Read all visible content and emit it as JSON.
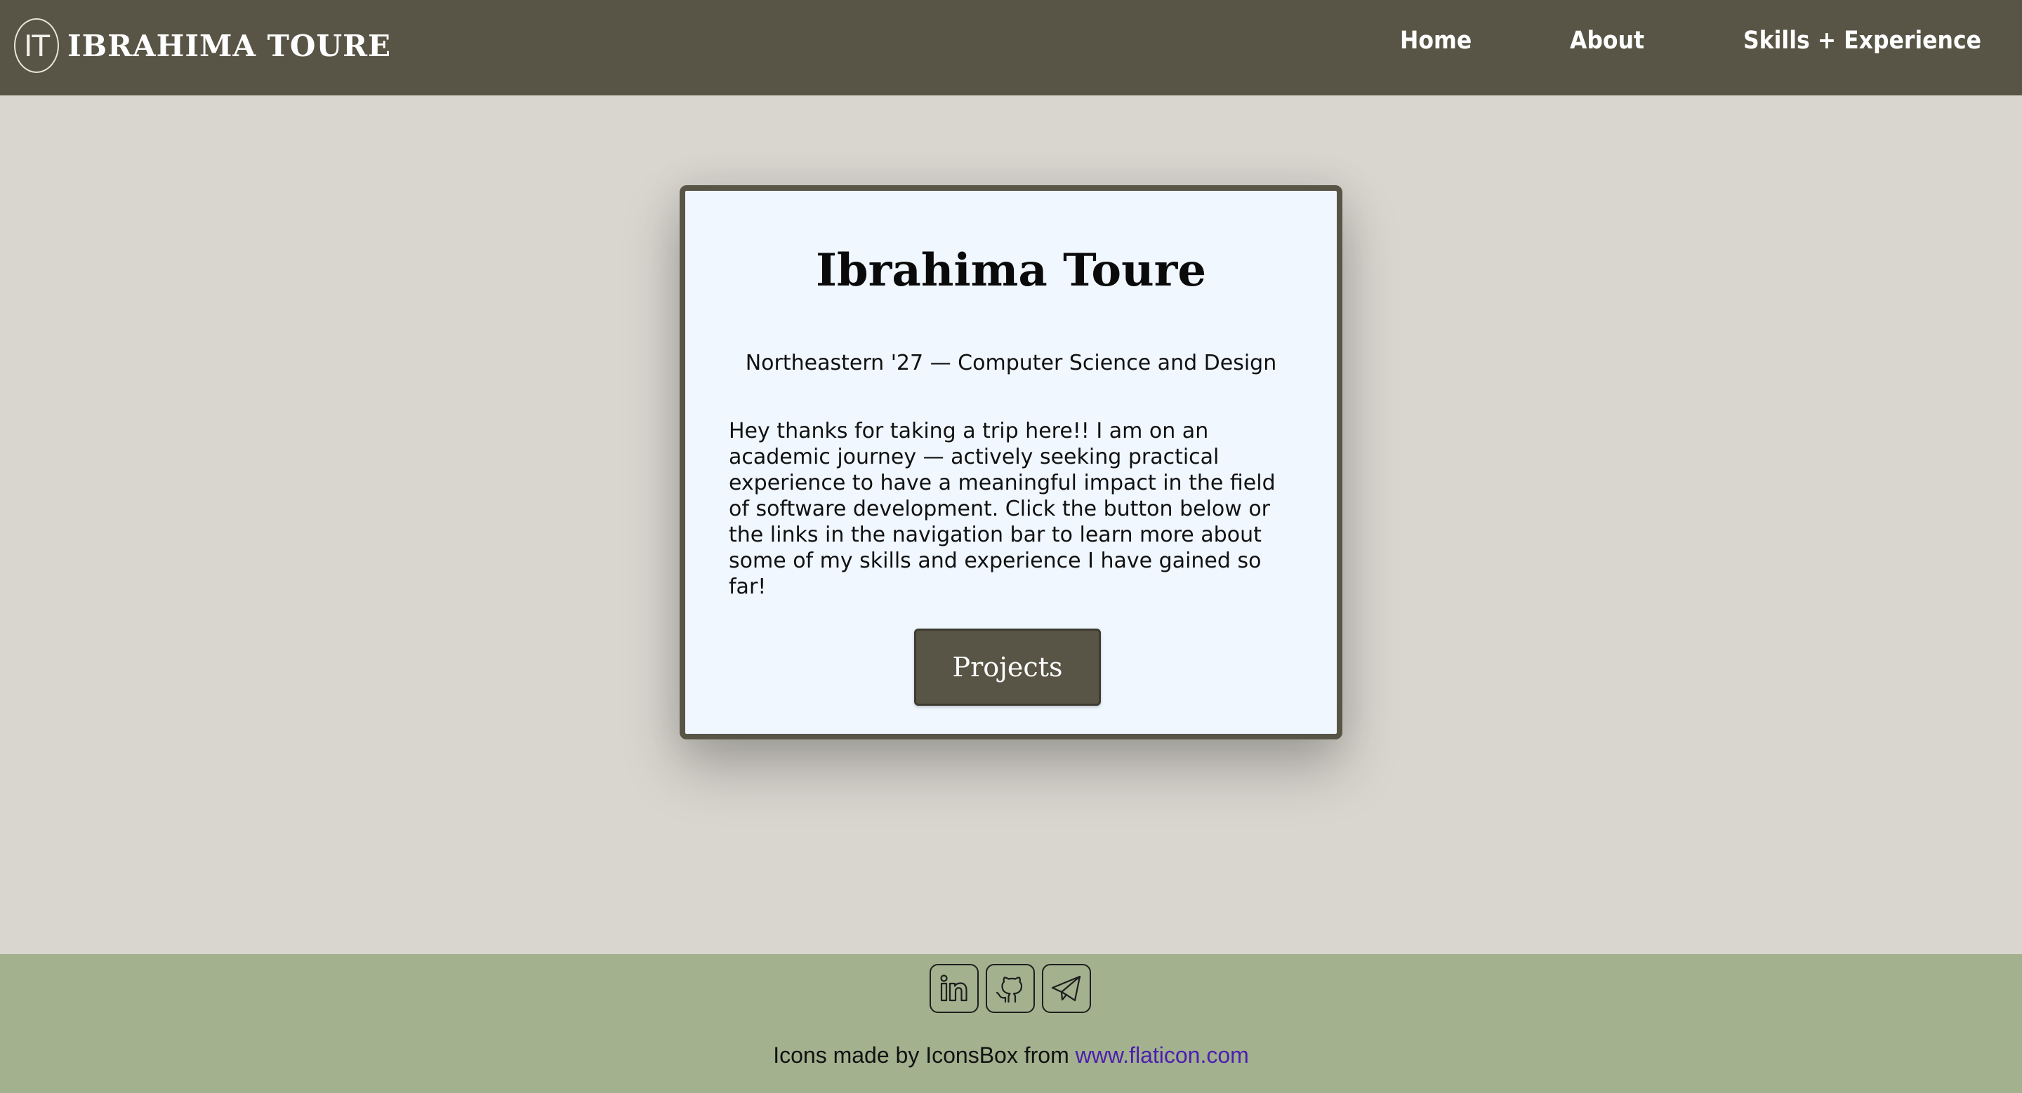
{
  "header": {
    "logo_text": "IT",
    "brand_name": "IBRAHIMA TOURE",
    "nav": {
      "home": "Home",
      "about": "About",
      "skills": "Skills + Experience"
    }
  },
  "card": {
    "title": "Ibrahima Toure",
    "subtitle": "Northeastern '27 — Computer Science and Design",
    "body": "Hey thanks for taking a trip here!! I am on an academic journey — actively seeking practical experience to have a meaningful impact in the field of software development. Click the button below or the links in the navigation bar to learn more about some of my skills and experience I have gained so far!",
    "button_label": "Projects"
  },
  "footer": {
    "icons": [
      "linkedin-icon",
      "github-icon",
      "telegram-icon"
    ],
    "credit_prefix": "Icons made by IconsBox from ",
    "credit_link": "www.flaticon.com"
  },
  "colors": {
    "nav_bg": "#585546",
    "page_bg": "#d9d6cf",
    "card_bg": "#f0f7ff",
    "footer_bg": "#a3b18e",
    "link": "#4b1fb0"
  }
}
